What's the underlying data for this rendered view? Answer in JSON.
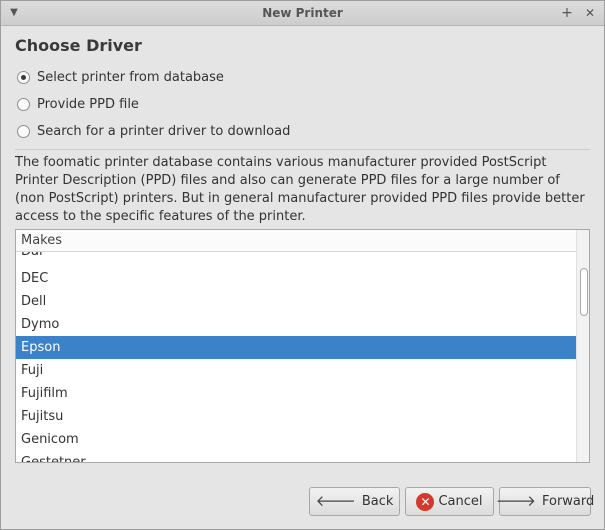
{
  "window": {
    "title": "New Printer"
  },
  "page": {
    "heading": "Choose Driver"
  },
  "options": [
    {
      "label": "Select printer from database",
      "selected": true
    },
    {
      "label": "Provide PPD file",
      "selected": false
    },
    {
      "label": "Search for a printer driver to download",
      "selected": false
    }
  ],
  "description": "The foomatic printer database contains various manufacturer provided PostScript Printer Description (PPD) files and also can generate PPD files for a large number of (non PostScript) printers. But in general manufacturer provided PPD files provide better access to the specific features of the printer.",
  "makes_list": {
    "header": "Makes",
    "items": [
      "Dai",
      "DEC",
      "Dell",
      "Dymo",
      "Epson",
      "Fuji",
      "Fujifilm",
      "Fujitsu",
      "Genicom",
      "Gestetner"
    ],
    "selected": "Epson"
  },
  "buttons": {
    "back": "Back",
    "cancel": "Cancel",
    "forward": "Forward"
  },
  "icons": {
    "window_menu": "chevron-down-icon",
    "pin": "plus-icon",
    "close": "close-icon",
    "back": "arrow-left-icon",
    "cancel": "cancel-icon",
    "forward": "arrow-right-icon"
  },
  "colors": {
    "selection": "#3b82c8",
    "cancel_icon": "#d33a2c"
  }
}
